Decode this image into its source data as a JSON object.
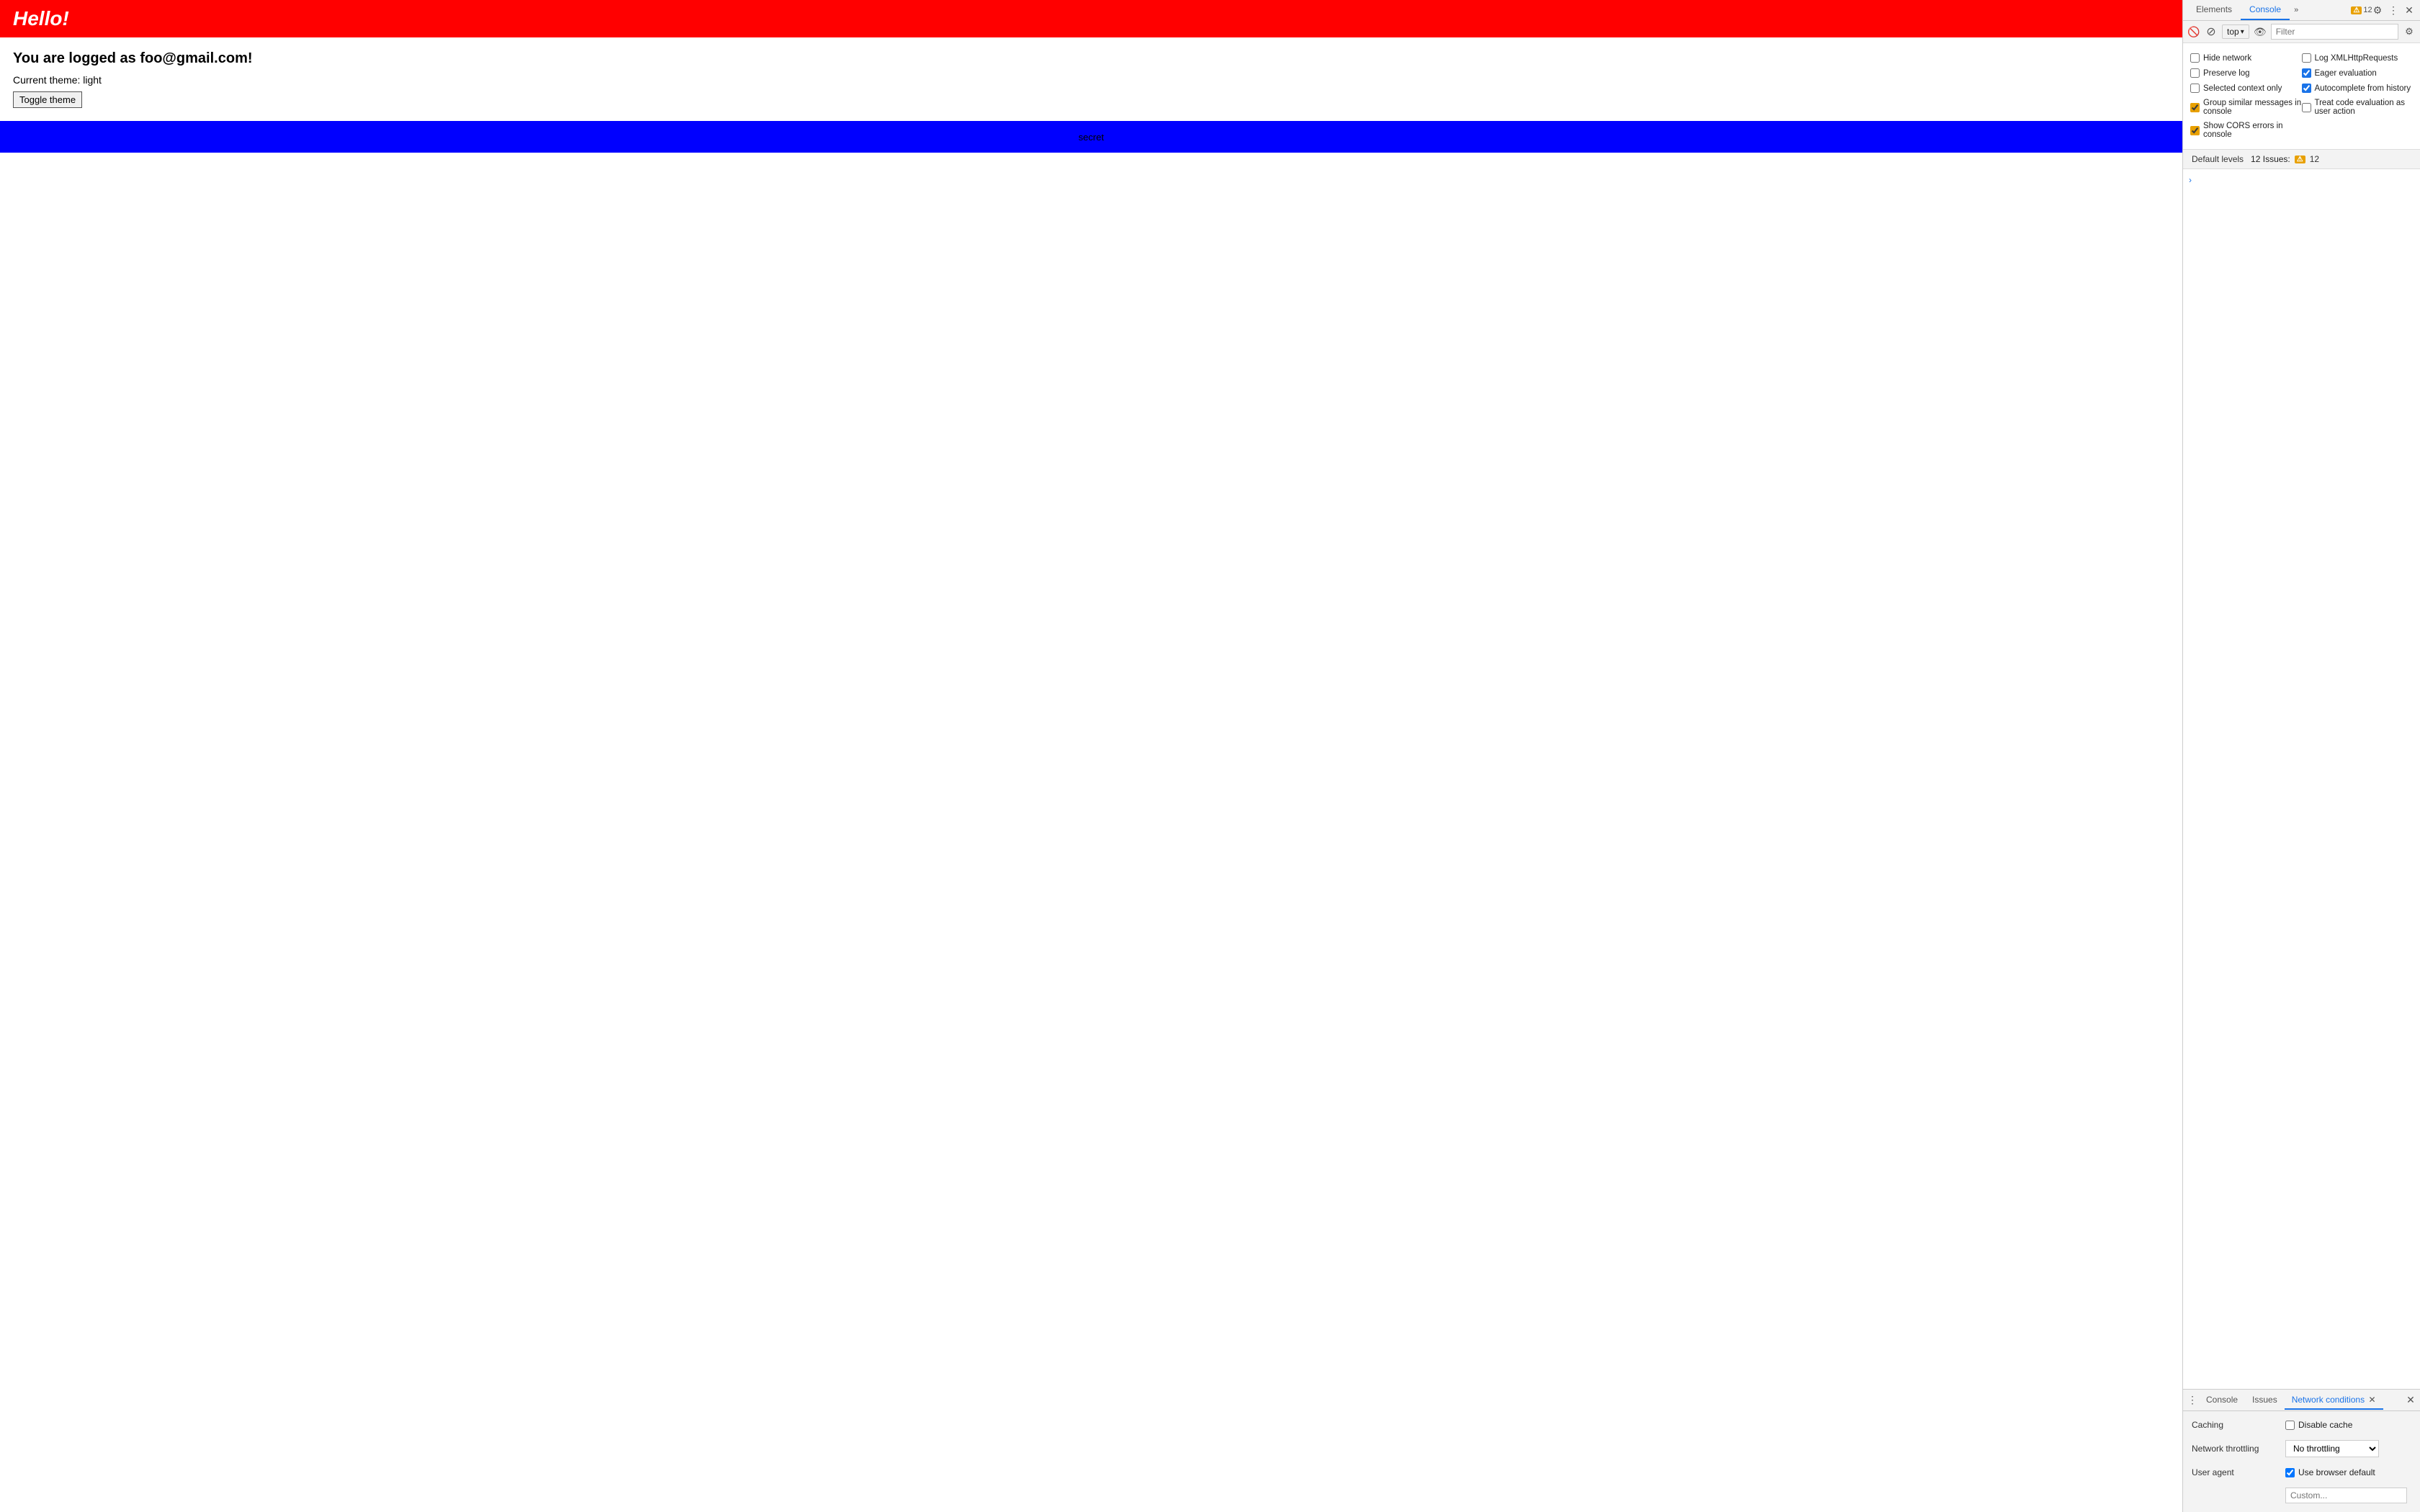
{
  "page": {
    "title": "Hello!",
    "logged_in": "You are logged as foo@gmail.com!",
    "theme_label": "Current theme:",
    "theme_value": "light",
    "toggle_btn": "Toggle theme",
    "secret": "secret",
    "cursor_char": ""
  },
  "devtools": {
    "toolbar": {
      "elements_tab": "Elements",
      "console_tab": "Console",
      "more_label": "»",
      "issues_badge": "12",
      "context_top": "top"
    },
    "filter": {
      "placeholder": "Filter",
      "default_levels": "Default levels",
      "issues_label": "12 Issues:",
      "issues_count": "12"
    },
    "settings": {
      "hide_network": "Hide network",
      "log_xml": "Log XMLHttpRequests",
      "preserve_log": "Preserve log",
      "eager_evaluation": "Eager evaluation",
      "selected_context_only": "Selected context only",
      "autocomplete_from_history": "Autocomplete from history",
      "group_similar": "Group similar messages in console",
      "treat_code_eval": "Treat code evaluation as user action",
      "show_cors": "Show CORS errors in console"
    },
    "bottom": {
      "console_tab": "Console",
      "issues_tab": "Issues",
      "network_conditions_tab": "Network conditions",
      "caching_label": "Caching",
      "disable_cache": "Disable cache",
      "throttling_label": "Network throttling",
      "throttling_value": "No throttling",
      "user_agent_label": "User agent",
      "use_browser_default": "Use browser default",
      "custom_label": "Custom..."
    }
  }
}
